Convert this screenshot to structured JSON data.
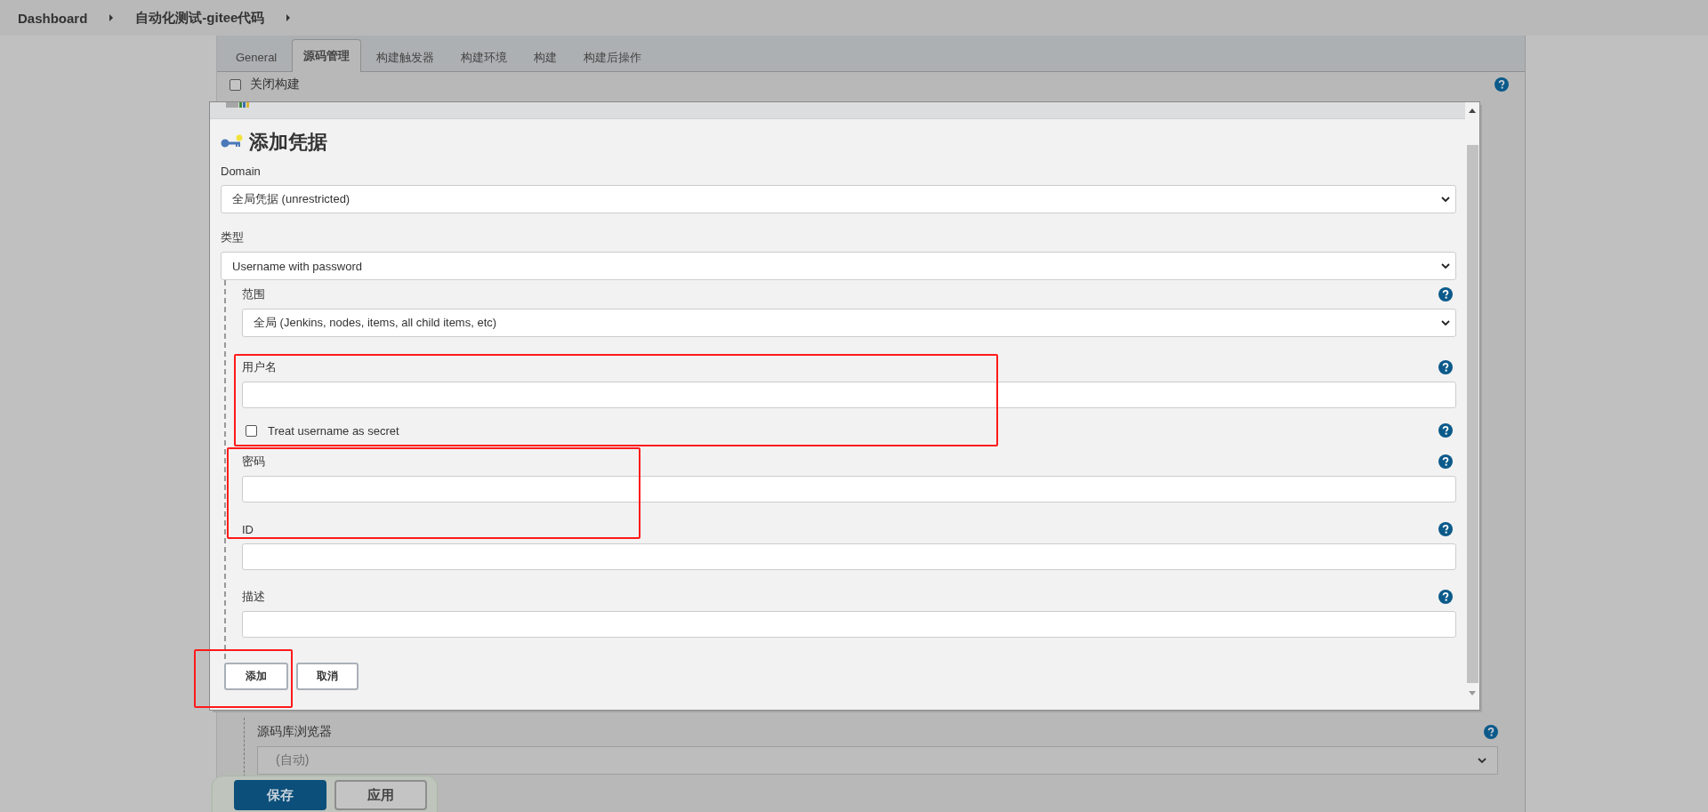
{
  "breadcrumb": [
    {
      "label": "Dashboard"
    },
    {
      "label": "自动化测试-gitee代码"
    }
  ],
  "tabs": [
    {
      "label": "General",
      "selected": false
    },
    {
      "label": "源码管理",
      "selected": true
    },
    {
      "label": "构建触发器",
      "selected": false
    },
    {
      "label": "构建环境",
      "selected": false
    },
    {
      "label": "构建",
      "selected": false
    },
    {
      "label": "构建后操作",
      "selected": false
    }
  ],
  "options": [
    {
      "label": "关闭构建",
      "checked": false
    }
  ],
  "dialog": {
    "title": "添加凭据",
    "fields": [
      {
        "kind": "select",
        "label": "Domain",
        "value": "全局凭据 (unrestricted)",
        "help": false
      },
      {
        "kind": "select",
        "label": "类型",
        "value": "Username with password",
        "help": false,
        "children": [
          {
            "kind": "select",
            "label": "范围",
            "value": "全局 (Jenkins, nodes, items, all child items, etc)",
            "help": true
          },
          {
            "kind": "text",
            "label": "用户名",
            "help": true
          },
          {
            "kind": "checkbox",
            "label": "Treat username as secret",
            "checked": false,
            "help": true
          },
          {
            "kind": "password",
            "label": "密码",
            "help": true
          },
          {
            "kind": "text",
            "label": "ID",
            "help": true
          },
          {
            "kind": "text",
            "label": "描述",
            "help": true
          }
        ]
      }
    ],
    "buttons": [
      {
        "label": "添加"
      },
      {
        "label": "取消"
      }
    ]
  },
  "browser": {
    "label": "源码库浏览器",
    "value": "(自动)"
  },
  "save_bar": {
    "buttons": [
      {
        "label": "保存",
        "primary": true
      },
      {
        "label": "应用",
        "primary": false
      }
    ]
  }
}
